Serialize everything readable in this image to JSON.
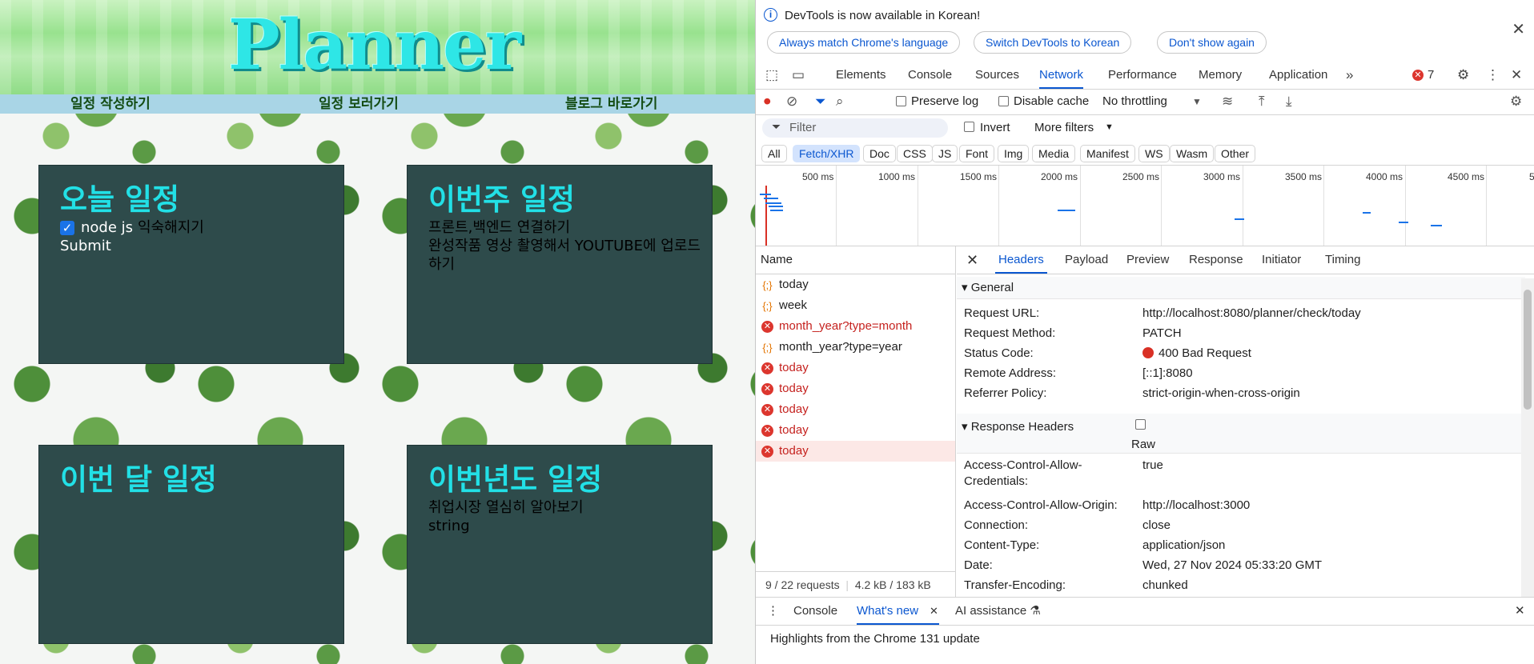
{
  "planner": {
    "logo": "Planner",
    "nav": [
      "일정 작성하기",
      "일정 보러가기",
      "블로그 바로가기"
    ],
    "cards": {
      "today": {
        "title": "오늘 일정",
        "item_prefix": "node js",
        "item_text": "익숙해지기",
        "submit": "Submit"
      },
      "week": {
        "title": "이번주 일정",
        "lines": [
          "프론트,백엔드 연결하기",
          "완성작품 영상 촬영해서 YOUTUBE에 업로드하기"
        ]
      },
      "month": {
        "title": "이번 달 일정"
      },
      "year": {
        "title": "이번년도 일정",
        "lines": [
          "취업시장 열심히 알아보기",
          "string"
        ]
      }
    }
  },
  "devtools": {
    "infobar": {
      "message": "DevTools is now available in Korean!",
      "buttons": [
        "Always match Chrome's language",
        "Switch DevTools to Korean",
        "Don't show again"
      ]
    },
    "tabs": [
      "Elements",
      "Console",
      "Sources",
      "Network",
      "Performance",
      "Memory",
      "Application"
    ],
    "active_tab": "Network",
    "error_count": "7",
    "toolbar": {
      "preserve_log": "Preserve log",
      "disable_cache": "Disable cache",
      "throttling": "No throttling"
    },
    "filter": {
      "placeholder": "Filter",
      "invert": "Invert",
      "more_filters": "More filters"
    },
    "types": [
      "All",
      "Fetch/XHR",
      "Doc",
      "CSS",
      "JS",
      "Font",
      "Img",
      "Media",
      "Manifest",
      "WS",
      "Wasm",
      "Other"
    ],
    "selected_type": "Fetch/XHR",
    "timeline_ticks": [
      "500 ms",
      "1000 ms",
      "1500 ms",
      "2000 ms",
      "2500 ms",
      "3000 ms",
      "3500 ms",
      "4000 ms",
      "4500 ms",
      "5"
    ],
    "requests": {
      "header": "Name",
      "rows": [
        {
          "name": "today",
          "status": "ok"
        },
        {
          "name": "week",
          "status": "ok"
        },
        {
          "name": "month_year?type=month",
          "status": "error"
        },
        {
          "name": "month_year?type=year",
          "status": "ok"
        },
        {
          "name": "today",
          "status": "error"
        },
        {
          "name": "today",
          "status": "error"
        },
        {
          "name": "today",
          "status": "error"
        },
        {
          "name": "today",
          "status": "error"
        },
        {
          "name": "today",
          "status": "error"
        }
      ],
      "summary_count": "9 / 22 requests",
      "summary_size": "4.2 kB / 183 kB"
    },
    "details": {
      "tabs": [
        "Headers",
        "Payload",
        "Preview",
        "Response",
        "Initiator",
        "Timing"
      ],
      "general_title": "General",
      "general": [
        {
          "k": "Request URL:",
          "v": "http://localhost:8080/planner/check/today"
        },
        {
          "k": "Request Method:",
          "v": "PATCH"
        },
        {
          "k": "Status Code:",
          "v": "400 Bad Request"
        },
        {
          "k": "Remote Address:",
          "v": "[::1]:8080"
        },
        {
          "k": "Referrer Policy:",
          "v": "strict-origin-when-cross-origin"
        }
      ],
      "response_title": "Response Headers",
      "raw_label": "Raw",
      "response": [
        {
          "k": "Access-Control-Allow-Credentials:",
          "v": "true"
        },
        {
          "k": "Access-Control-Allow-Origin:",
          "v": "http://localhost:3000"
        },
        {
          "k": "Connection:",
          "v": "close"
        },
        {
          "k": "Content-Type:",
          "v": "application/json"
        },
        {
          "k": "Date:",
          "v": "Wed, 27 Nov 2024 05:33:20 GMT"
        },
        {
          "k": "Transfer-Encoding:",
          "v": "chunked"
        }
      ]
    },
    "drawer": {
      "tabs": [
        "Console",
        "What's new",
        "AI assistance"
      ],
      "highlight": "Highlights from the Chrome 131 update"
    }
  }
}
